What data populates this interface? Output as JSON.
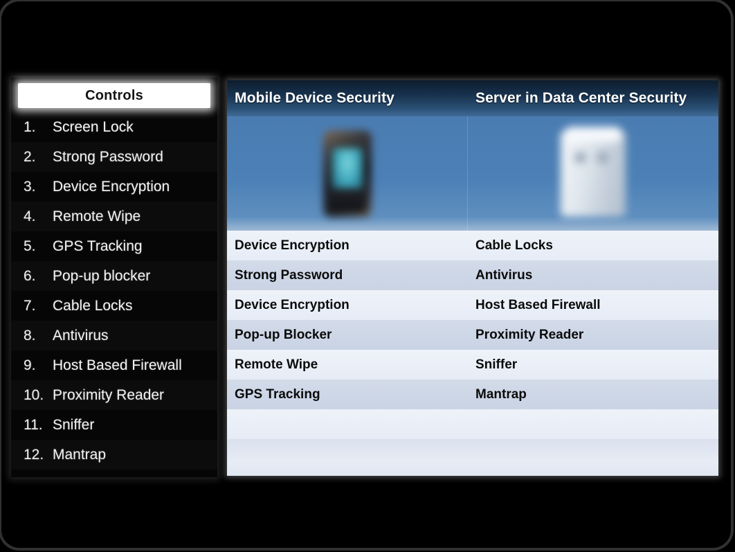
{
  "sidebar": {
    "header": "Controls",
    "items": [
      {
        "number": "1.",
        "label": "Screen Lock"
      },
      {
        "number": "2.",
        "label": "Strong Password"
      },
      {
        "number": "3.",
        "label": "Device Encryption"
      },
      {
        "number": "4.",
        "label": "Remote Wipe"
      },
      {
        "number": "5.",
        "label": "GPS Tracking"
      },
      {
        "number": "6.",
        "label": "Pop-up blocker"
      },
      {
        "number": "7.",
        "label": "Cable Locks"
      },
      {
        "number": "8.",
        "label": "Antivirus"
      },
      {
        "number": "9.",
        "label": "Host Based Firewall"
      },
      {
        "number": "10.",
        "label": "Proximity Reader"
      },
      {
        "number": "11.",
        "label": "Sniffer"
      },
      {
        "number": "12.",
        "label": "Mantrap"
      }
    ]
  },
  "table": {
    "columns": [
      {
        "header": "Mobile Device Security",
        "image": "smartphone-image"
      },
      {
        "header": "Server in Data Center Security",
        "image": "server-tower-image"
      }
    ],
    "rows": [
      {
        "mobile": "Device Encryption",
        "server": "Cable Locks"
      },
      {
        "mobile": "Strong Password",
        "server": "Antivirus"
      },
      {
        "mobile": "Device Encryption",
        "server": "Host Based Firewall"
      },
      {
        "mobile": "Pop-up Blocker",
        "server": "Proximity Reader"
      },
      {
        "mobile": "Remote Wipe",
        "server": "Sniffer"
      },
      {
        "mobile": "GPS Tracking",
        "server": "Mantrap"
      },
      {
        "mobile": "",
        "server": ""
      }
    ]
  },
  "colors": {
    "slide_background": "#000000",
    "header_blue_dark": "#0d1c2e",
    "image_cell_blue": "#4c80b6",
    "row_light": "#eef2f9",
    "row_dark": "#d3dbe9",
    "sidebar_text": "#f4f4f4",
    "controls_header_background": "#ffffff"
  }
}
